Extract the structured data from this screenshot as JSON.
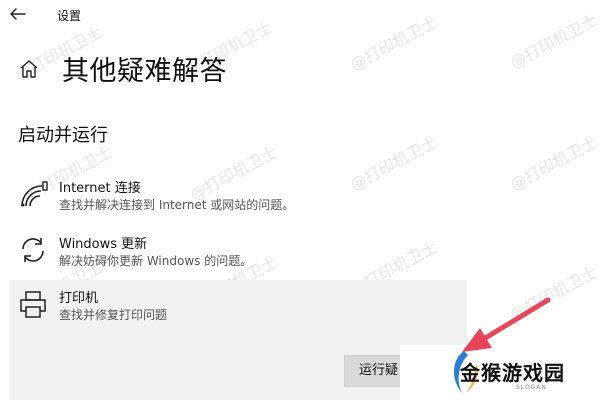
{
  "window": {
    "title": "设置"
  },
  "page": {
    "title": "其他疑难解答"
  },
  "section": {
    "title": "启动并运行"
  },
  "items": [
    {
      "title": "Internet 连接",
      "description": "查找并解决连接到 Internet 或网站的问题。",
      "icon": "wifi-icon"
    },
    {
      "title": "Windows 更新",
      "description": "解决妨碍你更新 Windows 的问题。",
      "icon": "sync-icon"
    },
    {
      "title": "打印机",
      "description": "查找并修复打印问题",
      "icon": "printer-icon",
      "selected": true
    }
  ],
  "run_button": {
    "label": "运行疑"
  },
  "watermark": {
    "text": "@打印机卫士"
  },
  "overlay_logo": {
    "text": "金猴游戏园",
    "sub": "SLOGAN"
  },
  "colors": {
    "selected_bg": "#f2f2f2",
    "button_bg": "#d9d9d9",
    "arrow": "#e8455a",
    "logo_blue": "#2a7fd4"
  }
}
